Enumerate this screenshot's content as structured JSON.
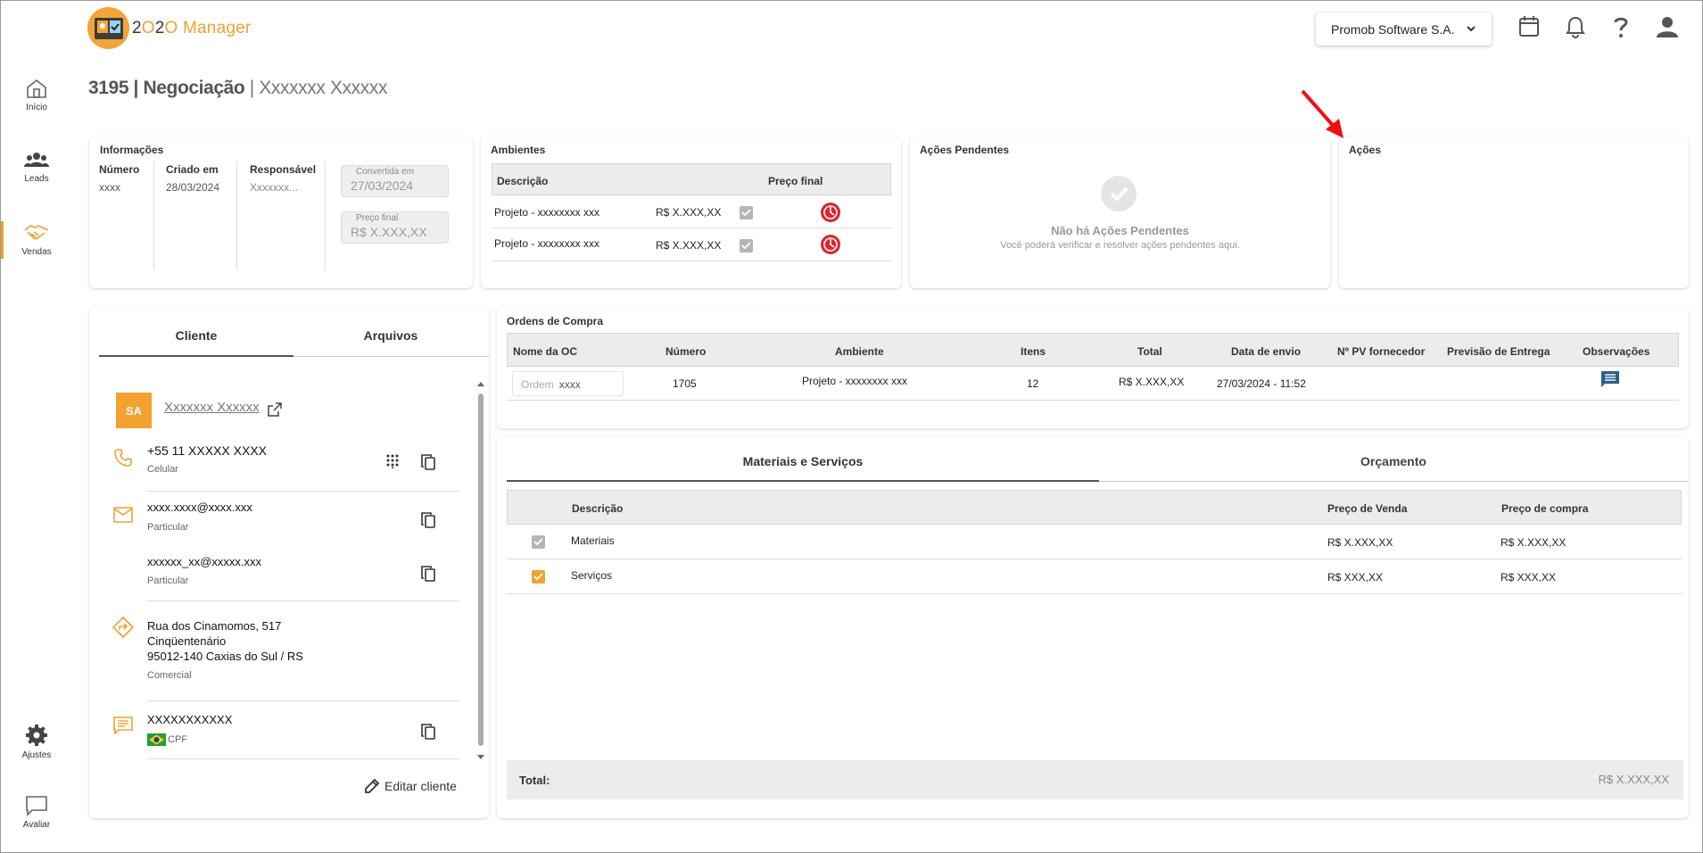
{
  "app": {
    "logo_text_prefix": "2",
    "logo_text_o": "O",
    "logo_text_two": "2",
    "logo_text_o2": "O",
    "logo_text_suffix": "Manager"
  },
  "header": {
    "company": "Promob Software S.A.",
    "icons": [
      "calendar-icon",
      "bell-icon",
      "help-icon",
      "account-icon"
    ]
  },
  "sidebar": {
    "items": [
      {
        "label": "Início",
        "icon": "home-icon"
      },
      {
        "label": "Leads",
        "icon": "people-icon"
      },
      {
        "label": "Vendas",
        "icon": "handshake-icon",
        "active": true
      },
      {
        "label": "Ajustes",
        "icon": "gear-icon"
      },
      {
        "label": "Avaliar",
        "icon": "chat-icon"
      }
    ]
  },
  "page": {
    "id": "3195",
    "stage": "Negociação",
    "client": "Xxxxxxx Xxxxxx"
  },
  "info": {
    "title": "Informações",
    "numero_label": "Número",
    "numero_value": "xxxx",
    "criado_label": "Criado em",
    "criado_value": "28/03/2024",
    "responsavel_label": "Responsável",
    "responsavel_value": "Xxxxxxx...",
    "convertida_label": "Convertida em",
    "convertida_value": "27/03/2024",
    "preco_label": "Preço final",
    "preco_value": "R$ X.XXX,XX"
  },
  "ambientes": {
    "title": "Ambientes",
    "col_descricao": "Descrição",
    "col_preco": "Preço final",
    "rows": [
      {
        "descricao": "Projeto - xxxxxxxx xxx",
        "preco": "R$ X.XXX,XX"
      },
      {
        "descricao": "Projeto - xxxxxxxx xxx",
        "preco": "R$ X.XXX,XX"
      }
    ]
  },
  "acoes_pendentes": {
    "title": "Ações Pendentes",
    "empty_title": "Não há Ações Pendentes",
    "empty_sub": "Você poderá verificar e resolver ações pendentes aqui."
  },
  "acoes": {
    "title": "Ações"
  },
  "left_tabs": {
    "cliente": "Cliente",
    "arquivos": "Arquivos"
  },
  "cliente": {
    "initials": "SA",
    "name": "Xxxxxxx Xxxxxx",
    "phone": "+55 11 XXXXX XXXX",
    "phone_type": "Celular",
    "email1": "xxxx.xxxx@xxxx.xxx",
    "email1_type": "Particular",
    "email2": "xxxxxx_xx@xxxxx.xxx",
    "email2_type": "Particular",
    "addr1": "Rua dos Cinamomos, 517",
    "addr2": "Cinqüentenário",
    "addr3": "95012-140 Caxias do Sul / RS",
    "addr_type": "Comercial",
    "doc": "XXXXXXXXXXX",
    "doc_type": "CPF",
    "edit_label": "Editar cliente"
  },
  "ordens": {
    "title": "Ordens de Compra",
    "columns": [
      "Nome da OC",
      "Número",
      "Ambiente",
      "Itens",
      "Total",
      "Data de envio",
      "Nº PV fornecedor",
      "Previsão de Entrega",
      "Observações"
    ],
    "row": {
      "oc_placeholder": "Ordem",
      "oc_value": "xxxx",
      "numero": "1705",
      "ambiente": "Projeto - xxxxxxxx xxx",
      "itens": "12",
      "total": "R$ X.XXX,XX",
      "data": "27/03/2024 - 11:52"
    }
  },
  "right_tabs": {
    "materiais": "Materiais e Serviços",
    "orcamento": "Orçamento"
  },
  "materiais": {
    "col_descricao": "Descrição",
    "col_venda": "Preço de Venda",
    "col_compra": "Preço de compra",
    "rows": [
      {
        "descricao": "Materiais",
        "venda": "R$ X.XXX,XX",
        "compra": "R$ X.XXX,XX"
      },
      {
        "descricao": "Serviços",
        "venda": "R$ XXX,XX",
        "compra": "R$ XXX,XX"
      }
    ],
    "total_label": "Total:",
    "total_value": "R$ X.XXX,XX"
  },
  "colors": {
    "accent": "#f0a030",
    "red_icon": "#d9282f",
    "comment_icon": "#2b5f8a"
  }
}
